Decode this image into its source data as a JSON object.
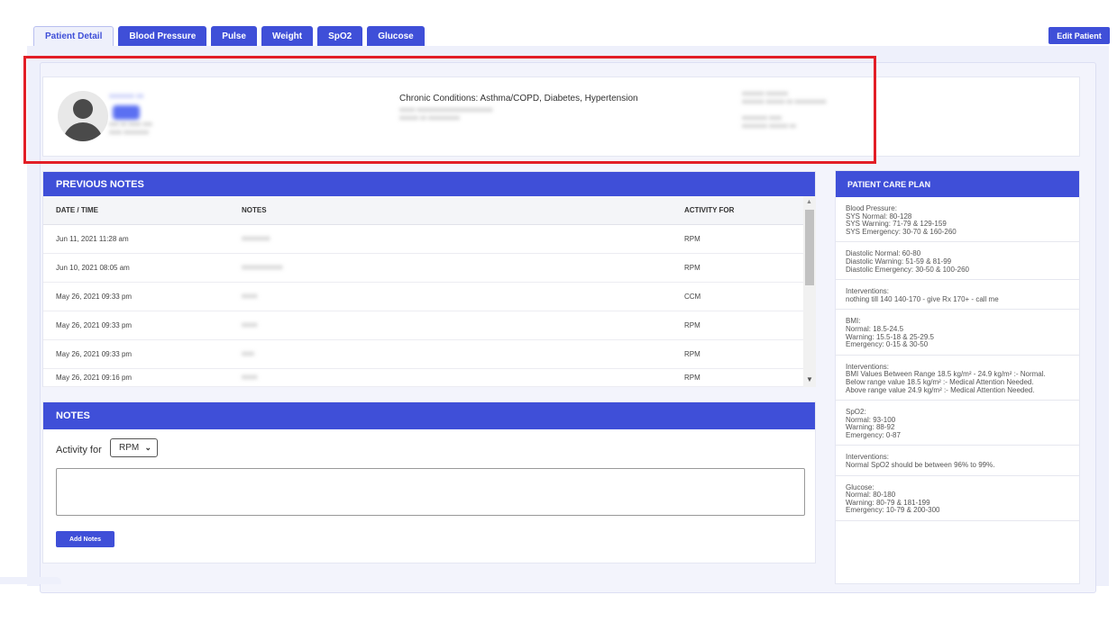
{
  "tabs": [
    {
      "label": "Patient Detail",
      "active": true
    },
    {
      "label": "Blood Pressure"
    },
    {
      "label": "Pulse"
    },
    {
      "label": "Weight"
    },
    {
      "label": "SpO2"
    },
    {
      "label": "Glucose"
    }
  ],
  "edit_patient_label": "Edit Patient",
  "patient": {
    "chronic_conditions": "Chronic Conditions: Asthma/COPD, Diabetes, Hypertension"
  },
  "previous_notes": {
    "title": "PREVIOUS NOTES",
    "columns": [
      "DATE / TIME",
      "NOTES",
      "ACTIVITY FOR"
    ],
    "rows": [
      {
        "datetime": "Jun 11, 2021 11:28 am",
        "activity": "RPM"
      },
      {
        "datetime": "Jun 10, 2021 08:05 am",
        "activity": "RPM"
      },
      {
        "datetime": "May 26, 2021 09:33 pm",
        "activity": "CCM"
      },
      {
        "datetime": "May 26, 2021 09:33 pm",
        "activity": "RPM"
      },
      {
        "datetime": "May 26, 2021 09:33 pm",
        "activity": "RPM"
      },
      {
        "datetime": "May 26, 2021 09:16 pm",
        "activity": "RPM"
      }
    ]
  },
  "notes_form": {
    "title": "NOTES",
    "activity_label": "Activity for",
    "activity_value": "RPM",
    "add_button": "Add Notes"
  },
  "care_plan": {
    "title": "PATIENT CARE PLAN",
    "items": [
      "Blood Pressure:\nSYS Normal: 80-128\nSYS Warning: 71-79 & 129-159\nSYS Emergency: 30-70 & 160-260",
      "Diastolic Normal: 60-80\nDiastolic Warning: 51-59 & 81-99\nDiastolic Emergency: 30-50 & 100-260",
      "Interventions:\nnothing till 140 140-170 - give Rx 170+ - call me",
      "BMI:\nNormal: 18.5-24.5\nWarning: 15.5-18 & 25-29.5\nEmergency: 0-15 & 30-50",
      "Interventions:\nBMI Values Between Range 18.5 kg/m² - 24.9 kg/m² :- Normal.\nBelow range value 18.5 kg/m² :- Medical Attention Needed.\nAbove range value 24.9 kg/m² :- Medical Attention Needed.",
      "SpO2:\nNormal: 93-100\nWarning: 88-92\nEmergency: 0-87",
      "Interventions:\nNormal SpO2 should be between 96% to 99%.",
      "Glucose:\nNormal: 80-180\nWarning: 80-79 & 181-199\nEmergency: 10-79 & 200-300"
    ]
  }
}
